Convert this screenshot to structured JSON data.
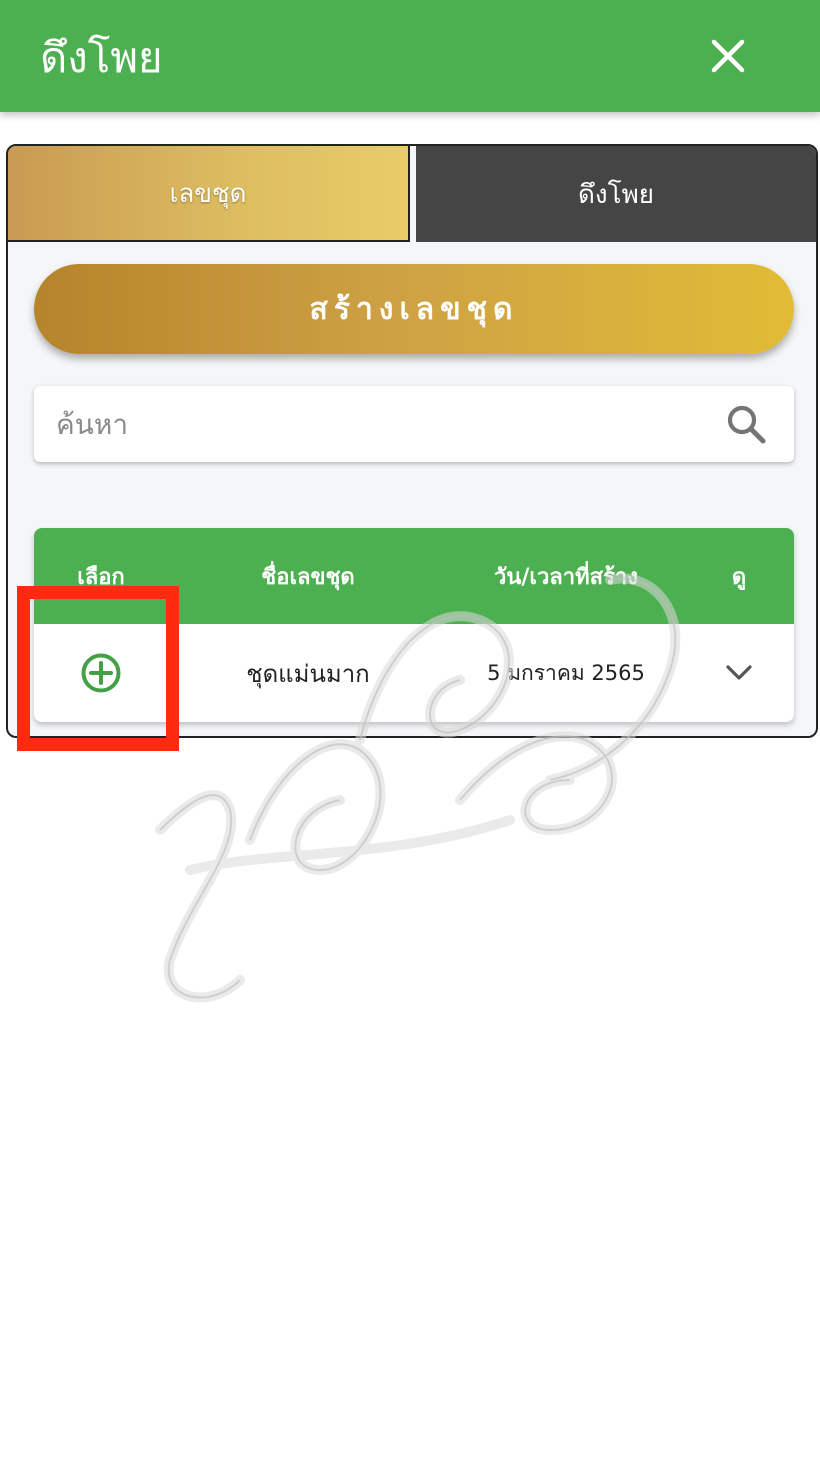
{
  "header": {
    "title": "ดึงโพย",
    "close_icon": "close-icon"
  },
  "tabs": [
    {
      "label": "เลขชุด",
      "active": true
    },
    {
      "label": "ดึงโพย",
      "active": false
    }
  ],
  "create_button": {
    "label": "สร้างเลขชุด"
  },
  "search": {
    "placeholder": "ค้นหา",
    "value": "",
    "icon": "search-icon"
  },
  "table": {
    "headers": [
      "เลือก",
      "ชื่อเลขชุด",
      "วัน/เวลาที่สร้าง",
      "ดู"
    ],
    "rows": [
      {
        "select_icon": "add-circle-icon",
        "name": "ชุดแม่นมาก",
        "date": "5 มกราคม 2565",
        "view_icon": "chevron-down-icon"
      }
    ]
  },
  "colors": {
    "header_green": "#4caf50",
    "gold": "#d4a840",
    "tab_dark": "#454545",
    "highlight_red": "#ff2a0f"
  }
}
